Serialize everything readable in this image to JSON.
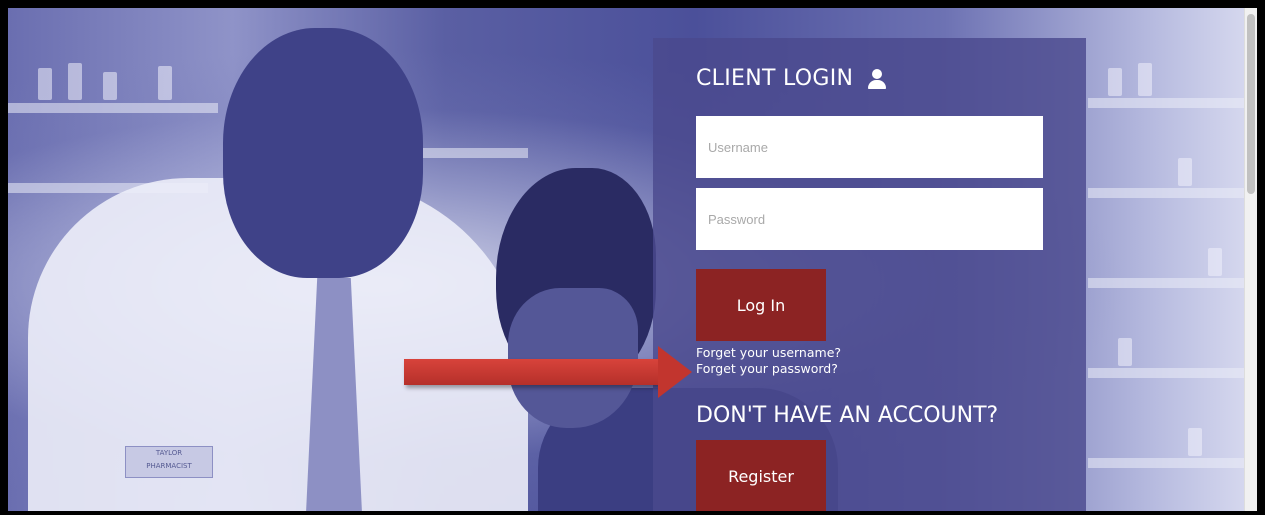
{
  "login": {
    "title": "CLIENT LOGIN",
    "username_placeholder": "Username",
    "password_placeholder": "Password",
    "login_button": "Log In",
    "forgot_username": "Forget your username?",
    "forgot_password": "Forget your password?"
  },
  "signup": {
    "heading": "DON'T HAVE AN ACCOUNT?",
    "register_button": "Register"
  },
  "badge_text": "TAYLOR\nPHARMACIST",
  "colors": {
    "panel": "#4a498e",
    "button": "#8c2323",
    "arrow": "#c2352e"
  },
  "icons": {
    "user": "user-icon"
  }
}
